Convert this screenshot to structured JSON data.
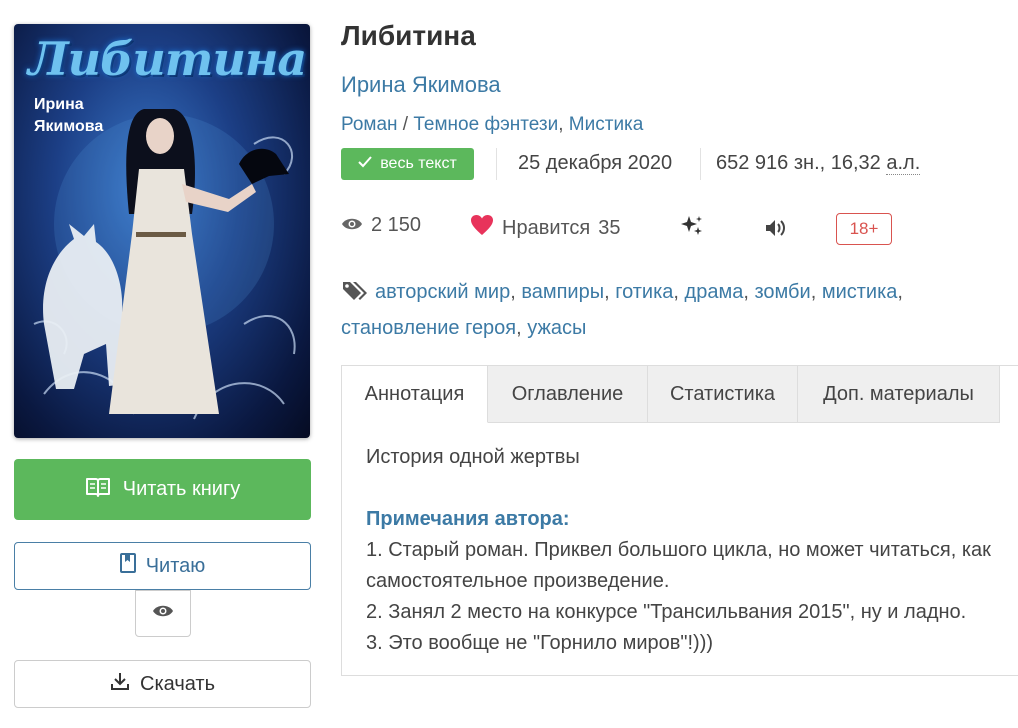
{
  "cover": {
    "title": "Либитина",
    "author_line1": "Ирина",
    "author_line2": "Якимова"
  },
  "actions": {
    "read_label": "Читать книгу",
    "reading_label": "Читаю",
    "download_label": "Скачать"
  },
  "book": {
    "title": "Либитина",
    "author": "Ирина Якимова",
    "genres": [
      "Роман",
      "Темное фэнтези",
      "Мистика"
    ],
    "genre_sep_slash": " / ",
    "genre_sep_comma": ", ",
    "status_badge": "весь текст",
    "date": "25 декабря 2020",
    "size_chars": "652 916 зн., 16,32",
    "size_unit": "а.л."
  },
  "stats": {
    "views": "2 150",
    "likes_label": "Нравится",
    "likes_count": "35",
    "age_rating": "18+"
  },
  "tags": [
    "авторский мир",
    "вампиры",
    "готика",
    "драма",
    "зомби",
    "мистика",
    "становление героя",
    "ужасы"
  ],
  "tabs": [
    "Аннотация",
    "Оглавление",
    "Статистика",
    "Доп. материалы"
  ],
  "annotation": {
    "summary": "История одной жертвы",
    "notes_title": "Примечания автора:",
    "notes": [
      "1. Старый роман. Приквел большого цикла, но может читаться, как",
      "самостоятельное произведение.",
      "2. Занял 2 место на конкурсе \"Трансильвания 2015\", ну и ладно.",
      "3. Это вообще не \"Горнило миров\"!)))"
    ]
  },
  "colors": {
    "accent_blue": "#3c7aa5",
    "green": "#5cb85c",
    "heart": "#e8335b",
    "age_red": "#d9534f"
  }
}
